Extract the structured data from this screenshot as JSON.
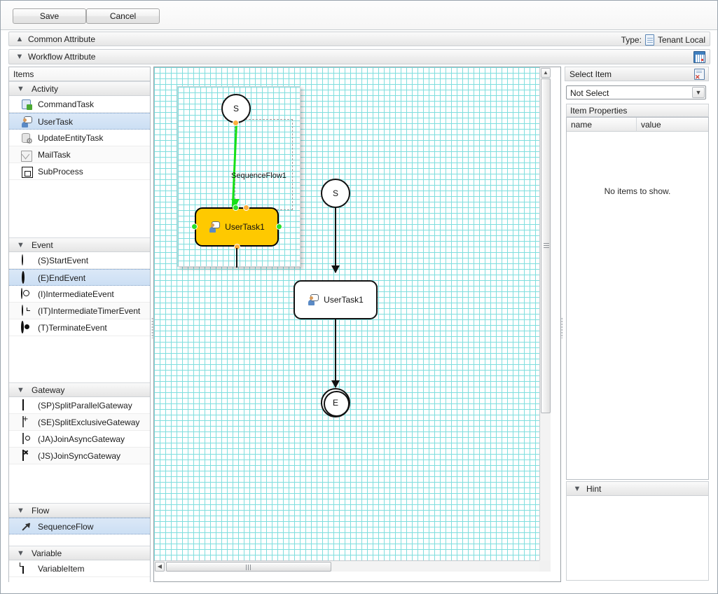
{
  "toolbar": {
    "save_label": "Save",
    "cancel_label": "Cancel"
  },
  "strips": {
    "common_attribute": "Common Attribute",
    "workflow_attribute": "Workflow Attribute",
    "type_label": "Type:",
    "type_value": "Tenant Local",
    "common_chevron": "▲",
    "workflow_chevron": "▼",
    "doc_icon": "document-icon",
    "grid_icon": "table-grid-icon"
  },
  "left_panel": {
    "title": "Items",
    "groups": [
      {
        "label": "Activity",
        "chevron": "▼",
        "items": [
          {
            "label": "CommandTask",
            "icon": "command-task-icon",
            "selected": false
          },
          {
            "label": "UserTask",
            "icon": "user-task-icon",
            "selected": true
          },
          {
            "label": "UpdateEntityTask",
            "icon": "update-entity-task-icon",
            "selected": false
          },
          {
            "label": "MailTask",
            "icon": "mail-task-icon",
            "selected": false
          },
          {
            "label": "SubProcess",
            "icon": "sub-process-icon",
            "selected": false
          }
        ]
      },
      {
        "label": "Event",
        "chevron": "▼",
        "items": [
          {
            "label": "(S)StartEvent",
            "icon": "start-event-icon",
            "selected": false
          },
          {
            "label": "(E)EndEvent",
            "icon": "end-event-icon",
            "selected": true
          },
          {
            "label": "(I)IntermediateEvent",
            "icon": "intermediate-event-icon",
            "selected": false
          },
          {
            "label": "(IT)IntermediateTimerEvent",
            "icon": "intermediate-timer-event-icon",
            "selected": false
          },
          {
            "label": "(T)TerminateEvent",
            "icon": "terminate-event-icon",
            "selected": false
          }
        ]
      },
      {
        "label": "Gateway",
        "chevron": "▼",
        "items": [
          {
            "label": "(SP)SplitParallelGateway",
            "icon": "split-parallel-gateway-icon",
            "selected": false
          },
          {
            "label": "(SE)SplitExclusiveGateway",
            "icon": "split-exclusive-gateway-icon",
            "selected": false
          },
          {
            "label": "(JA)JoinAsyncGateway",
            "icon": "join-async-gateway-icon",
            "selected": false
          },
          {
            "label": "(JS)JoinSyncGateway",
            "icon": "join-sync-gateway-icon",
            "selected": false
          }
        ]
      },
      {
        "label": "Flow",
        "chevron": "▼",
        "items": [
          {
            "label": "SequenceFlow",
            "icon": "sequence-flow-icon",
            "selected": true
          }
        ]
      },
      {
        "label": "Variable",
        "chevron": "▼",
        "items": [
          {
            "label": "VariableItem",
            "icon": "variable-item-icon",
            "selected": false
          }
        ]
      }
    ]
  },
  "canvas": {
    "grid_color": "#7fdede",
    "nodes": [
      {
        "id": "start",
        "type": "start-event",
        "label": "S"
      },
      {
        "id": "task1",
        "type": "user-task",
        "label": "UserTask1"
      },
      {
        "id": "end",
        "type": "end-event",
        "label": "E"
      }
    ],
    "drag_overlay": {
      "flow_label": "SequenceFlow1",
      "start_label": "S",
      "task_label": "UserTask1",
      "highlight_color": "#fec900",
      "flow_color": "#16e016",
      "handle_color": "#ffae3c",
      "anchor_color": "#28e028"
    },
    "vertical_scrollbar": {
      "up_arrow": "▲",
      "down_arrow": "▼"
    },
    "horizontal_scrollbar": {
      "left_arrow": "◀",
      "right_arrow": "▶"
    }
  },
  "right_panel": {
    "select_item_title": "Select Item",
    "clear_icon": "clear-selection-icon",
    "combo_value": "Not Select",
    "combo_arrow": "▼",
    "item_properties_title": "Item Properties",
    "columns": {
      "name": "name",
      "value": "value"
    },
    "empty_message": "No items to show.",
    "hint_label": "Hint",
    "hint_chevron": "▼"
  }
}
